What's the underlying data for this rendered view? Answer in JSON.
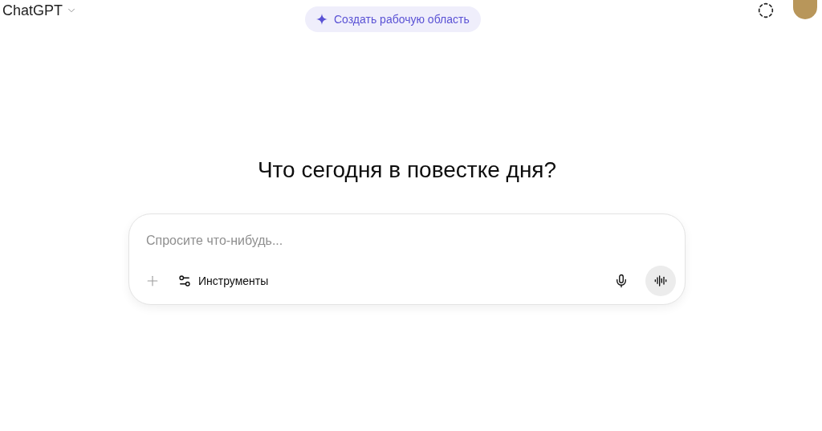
{
  "header": {
    "title": "ChatGPT",
    "workspace_button": "Создать рабочую область"
  },
  "heading": "Что сегодня в повестке дня?",
  "composer": {
    "placeholder": "Спросите что-нибудь...",
    "tools_button": "Инструменты"
  }
}
